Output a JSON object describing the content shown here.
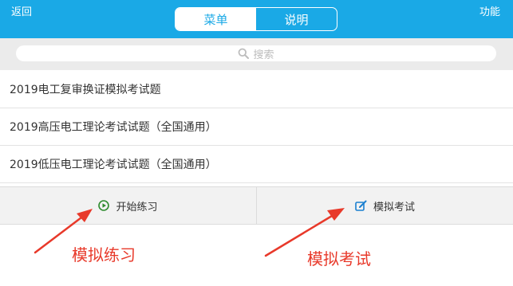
{
  "header": {
    "back_label": "返回",
    "function_label": "功能",
    "tabs": [
      {
        "label": "菜单",
        "active": true
      },
      {
        "label": "说明",
        "active": false
      }
    ]
  },
  "search": {
    "placeholder": "搜索",
    "icon": "search-icon"
  },
  "list": {
    "items": [
      {
        "label": "2019电工复审换证模拟考试题"
      },
      {
        "label": "2019高压电工理论考试试题（全国通用）"
      },
      {
        "label": "2019低压电工理论考试试题（全国通用）"
      }
    ]
  },
  "actions": {
    "practice": {
      "label": "开始练习",
      "icon": "play-circle-icon",
      "color": "#2e8b2e"
    },
    "exam": {
      "label": "模拟考试",
      "icon": "edit-icon",
      "color": "#1a7fd0"
    }
  },
  "annotations": {
    "practice_note": "模拟练习",
    "exam_note": "模拟考试",
    "color": "#e8392a"
  },
  "colors": {
    "header_bg": "#1aa9e6",
    "search_bg": "#ebebeb",
    "action_bg": "#f2f2f2"
  }
}
